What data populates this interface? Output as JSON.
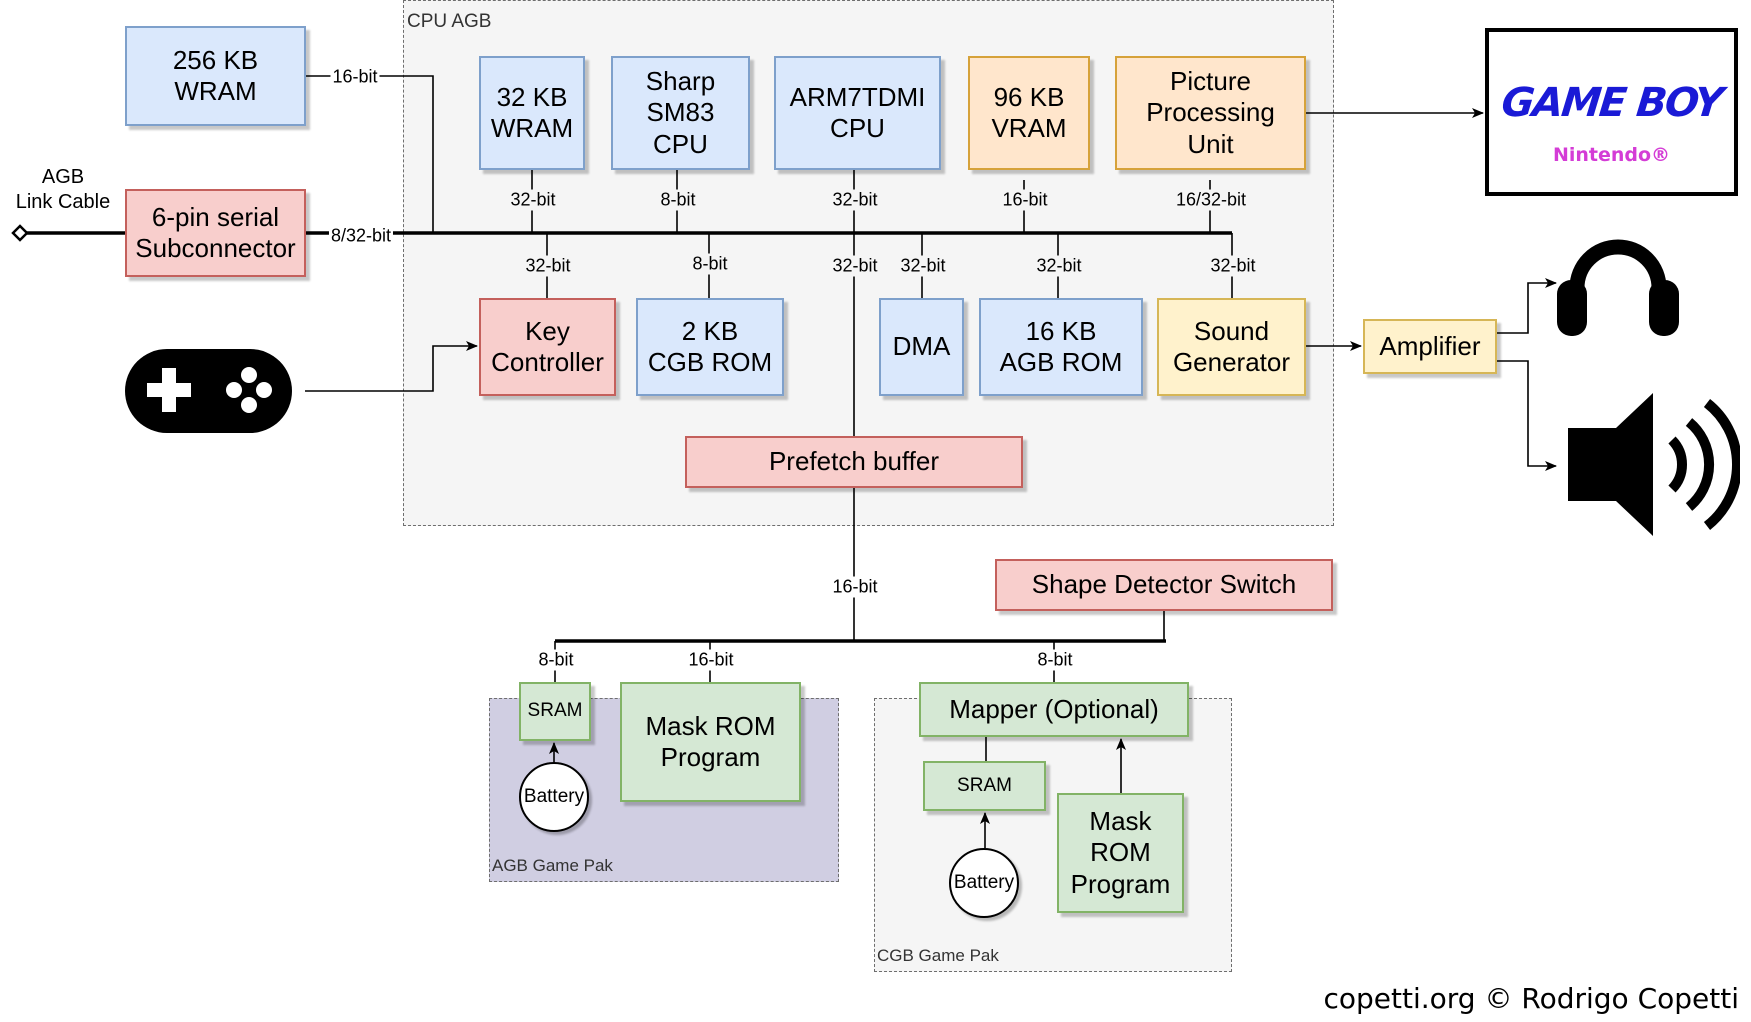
{
  "diagram": {
    "groups": {
      "cpu_agb": "CPU AGB",
      "agb_game_pak": "AGB Game Pak",
      "cgb_game_pak": "CGB Game Pak"
    },
    "external": {
      "wram_256": "256 KB\nWRAM",
      "serial": "6-pin serial\nSubconnector",
      "link_cable": "AGB\nLink Cable",
      "gamepad_icon": "gamepad-icon"
    },
    "cpu_top": {
      "wram_32": "32 KB\nWRAM",
      "sharp": "Sharp\nSM83\nCPU",
      "arm7": "ARM7TDMI\nCPU",
      "vram": "96 KB\nVRAM",
      "ppu": "Picture\nProcessing\nUnit"
    },
    "cpu_bottom": {
      "key": "Key\nController",
      "cgb_rom": "2 KB\nCGB ROM",
      "dma": "DMA",
      "agb_rom": "16 KB\nAGB ROM",
      "sound": "Sound\nGenerator"
    },
    "prefetch": "Prefetch buffer",
    "amplifier": "Amplifier",
    "display": {
      "title": "GAME BOY",
      "subtitle": "Nintendo®",
      "title_color": "#1a1ad6",
      "subtitle_color": "#d43cd6"
    },
    "audio_outputs": [
      "headphones-icon",
      "speaker-icon"
    ],
    "shape_switch": "Shape Detector Switch",
    "agb_pak": {
      "sram": "SRAM",
      "battery": "Battery",
      "mask_rom": "Mask ROM\nProgram"
    },
    "cgb_pak": {
      "mapper": "Mapper (Optional)",
      "sram": "SRAM",
      "battery": "Battery",
      "mask_rom": "Mask\nROM\nProgram"
    },
    "bus_labels": {
      "wram256": "16-bit",
      "serial": "8/32-bit",
      "wram32": "32-bit",
      "sharp": "8-bit",
      "arm7_up": "32-bit",
      "vram": "16-bit",
      "ppu": "16/32-bit",
      "key": "32-bit",
      "cgb_rom": "8-bit",
      "arm7_down": "32-bit",
      "dma": "32-bit",
      "agb_rom": "32-bit",
      "sound": "32-bit",
      "cart": "16-bit",
      "agb_sram": "8-bit",
      "agb_rom_cart": "16-bit",
      "cgb_mapper": "8-bit"
    },
    "footer": "copetti.org © Rodrigo Copetti"
  }
}
